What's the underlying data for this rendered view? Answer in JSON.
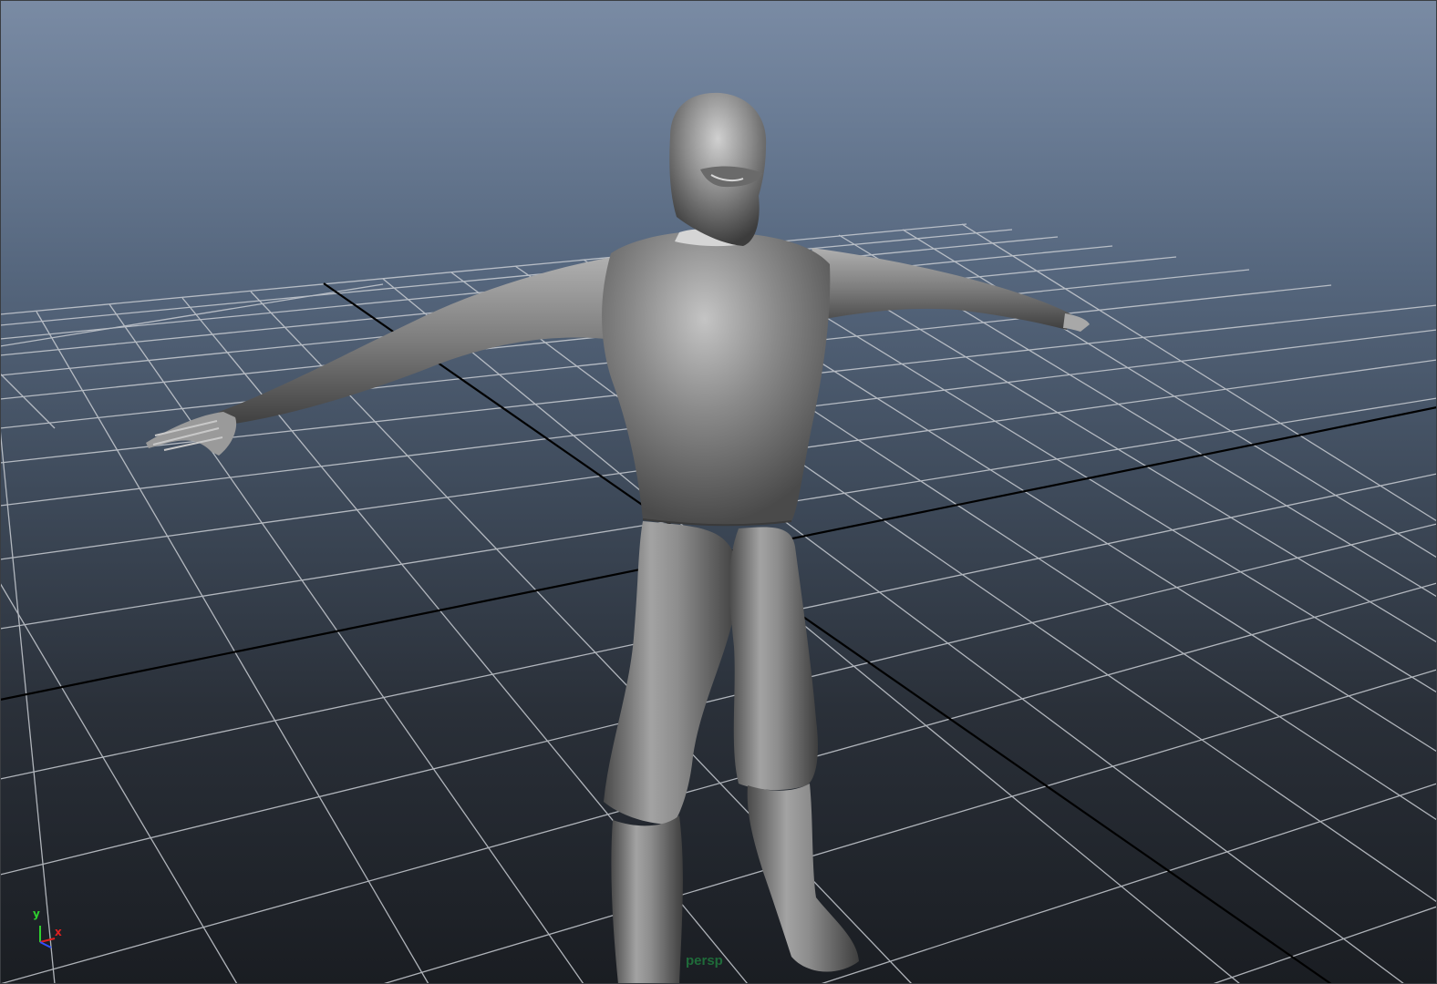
{
  "viewport": {
    "camera_label": "persp",
    "background_top": "#7a8ba4",
    "background_bottom": "#1a1d22",
    "grid_color": "#c9cdd3",
    "axis_line_color": "#000000"
  },
  "axis_gizmo": {
    "y_label": "y",
    "x_label": "x",
    "y_color": "#2fd12f",
    "x_color": "#e02020",
    "z_color": "#3050ff"
  },
  "model": {
    "name": "character-mesh",
    "pose": "T-pose",
    "material_color": "#8a8a8a"
  }
}
